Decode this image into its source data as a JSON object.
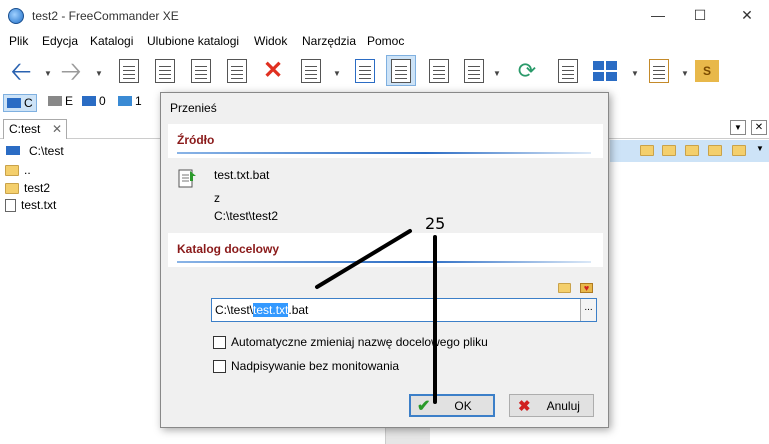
{
  "window": {
    "title": "test2 - FreeCommander XE"
  },
  "menu": [
    "Plik",
    "Edycja",
    "Katalogi",
    "Ulubione katalogi",
    "Widok",
    "Narzędzia",
    "Pomoc"
  ],
  "drives": [
    {
      "letter": "C"
    },
    {
      "letter": "E"
    },
    {
      "letter": "0"
    },
    {
      "letter": "1"
    }
  ],
  "panel": {
    "tab_label": "C:test",
    "path": "C:\\test",
    "files": [
      {
        "name": "..",
        "type": "folder"
      },
      {
        "name": "test2",
        "type": "folder"
      },
      {
        "name": "test.txt",
        "type": "file"
      }
    ]
  },
  "dialog": {
    "title": "Przenieś",
    "source_heading": "Źródło",
    "source_file": "test.txt.bat",
    "from_label": "z",
    "source_path": "C:\\test\\test2",
    "target_heading": "Katalog docelowy",
    "target_prefix": "C:\\test\\",
    "target_selected": "test.txt",
    "target_suffix": ".bat",
    "browse_label": "...",
    "option_auto_rename": "Automatyczne zmieniaj nazwę docelowego pliku",
    "option_overwrite": "Nadpisywanie bez monitowania",
    "ok_label": "OK",
    "cancel_label": "Anuluj"
  },
  "annotation": {
    "number": "25"
  },
  "colors": {
    "accent": "#2b6cc4",
    "heading": "#8a1a1a",
    "selection": "#3399ff"
  }
}
